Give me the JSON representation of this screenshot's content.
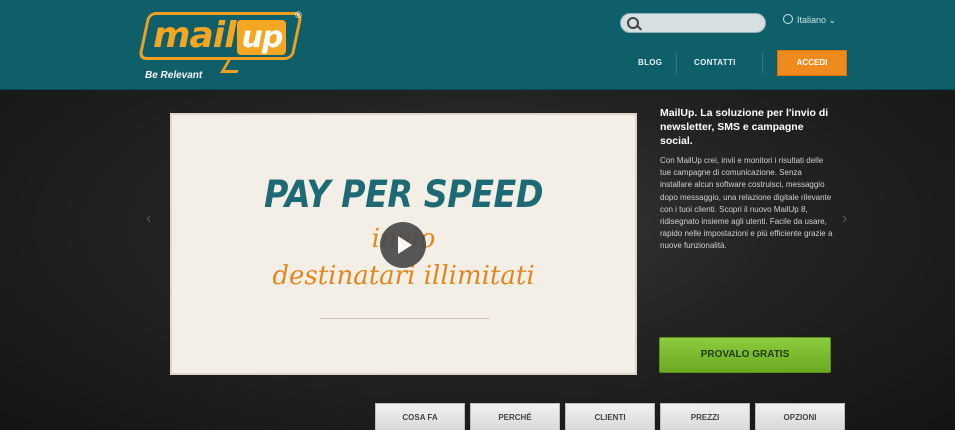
{
  "header": {
    "logo_text_main": "mail",
    "logo_text_accent": "up",
    "logo_reg": "®",
    "tagline": "Be Relevant",
    "search_placeholder": "",
    "language": "Italiano ⌄",
    "nav": [
      "BLOG",
      "CONTATTI"
    ],
    "accedi_label": "ACCEDI"
  },
  "hero": {
    "video": {
      "title": "PAY PER SPEED",
      "line2": "invio",
      "line3": "destinatari illimitati"
    },
    "side_title": "MailUp. La soluzione per l'invio di newsletter, SMS e campagne social.",
    "side_body": "Con MailUp crei, invii e monitori i risultati delle tue campagne di comunicazione. Senza installare alcun software costruisci, messaggio dopo messaggio, una relazione digitale rilevante con i tuoi clienti. Scopri il nuovo MailUp 8, ridisegnato insieme agli utenti. Facile da usare, rapido nelle impostazioni e più efficiente grazie a nuove funzionalità.",
    "cta_label": "PROVALO GRATIS"
  },
  "tabs": [
    "COSA FA",
    "PERCHÉ",
    "CLIENTI",
    "PREZZI",
    "OPZIONI"
  ],
  "colors": {
    "header_bg": "#0e5f6a",
    "accent_orange": "#f08a1d",
    "cta_green": "#7bbb2e"
  }
}
